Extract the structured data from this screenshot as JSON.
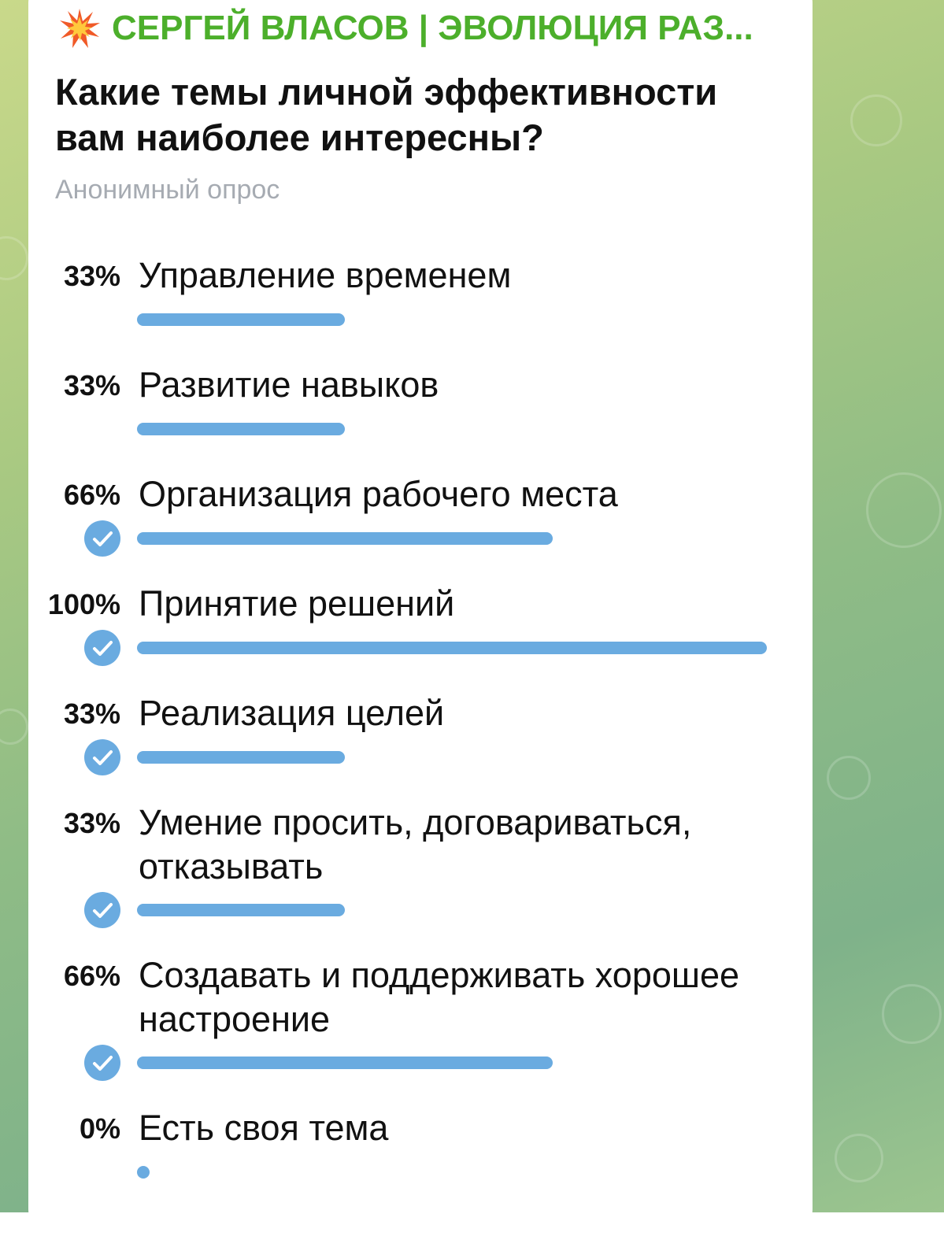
{
  "channel": {
    "icon": "collision-icon",
    "title": "СЕРГЕЙ ВЛАСОВ | ЭВОЛЮЦИЯ РАЗ..."
  },
  "poll": {
    "question": "Какие темы личной эффективности вам наиболее интересны?",
    "type_label": "Анонимный опрос",
    "options": [
      {
        "percent_label": "33%",
        "text": "Управление временем",
        "fraction": 0.33,
        "chosen": false
      },
      {
        "percent_label": "33%",
        "text": "Развитие навыков",
        "fraction": 0.33,
        "chosen": false
      },
      {
        "percent_label": "66%",
        "text": "Организация рабочего места",
        "fraction": 0.66,
        "chosen": true
      },
      {
        "percent_label": "100%",
        "text": "Принятие решений",
        "fraction": 1.0,
        "chosen": true
      },
      {
        "percent_label": "33%",
        "text": "Реализация целей",
        "fraction": 0.33,
        "chosen": true
      },
      {
        "percent_label": "33%",
        "text": "Умение просить, договариваться, отказывать",
        "fraction": 0.33,
        "chosen": true
      },
      {
        "percent_label": "66%",
        "text": "Создавать и поддерживать хорошее настроение",
        "fraction": 0.66,
        "chosen": true
      },
      {
        "percent_label": "0%",
        "text": "Есть своя тема",
        "fraction": 0.0,
        "chosen": false
      }
    ]
  },
  "colors": {
    "accent": "#6aabe0",
    "channel_title": "#4caf2b",
    "subtitle": "#a6abb2"
  }
}
